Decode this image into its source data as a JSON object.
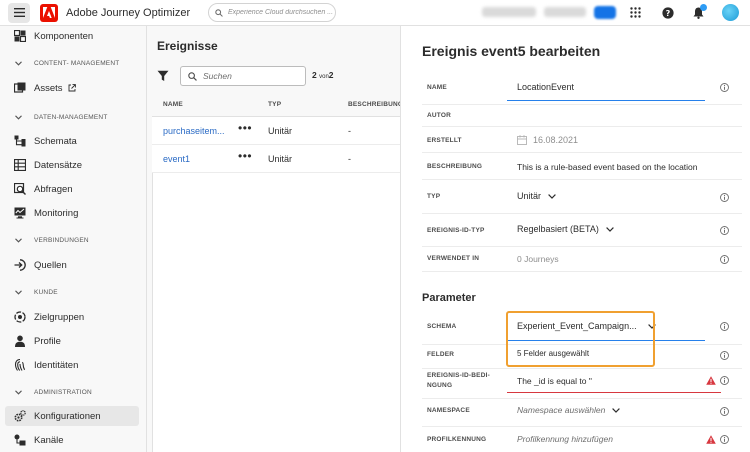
{
  "app": {
    "title": "Adobe Journey Optimizer",
    "search_placeholder": "Experience Cloud durchsuchen ..."
  },
  "nav": {
    "items": [
      {
        "label": "Komponenten",
        "icon": "components-icon"
      },
      {
        "label": "Assets",
        "icon": "assets-icon"
      },
      {
        "label": "Schemata",
        "icon": "schema-icon"
      },
      {
        "label": "Datensätze",
        "icon": "datasets-icon"
      },
      {
        "label": "Abfragen",
        "icon": "queries-icon"
      },
      {
        "label": "Monitoring",
        "icon": "monitoring-icon"
      },
      {
        "label": "Quellen",
        "icon": "sources-icon"
      },
      {
        "label": "Zielgruppen",
        "icon": "audiences-icon"
      },
      {
        "label": "Profile",
        "icon": "profile-icon"
      },
      {
        "label": "Identitäten",
        "icon": "identities-icon"
      },
      {
        "label": "Konfigurationen",
        "icon": "gear-icon",
        "active": true
      },
      {
        "label": "Kanäle",
        "icon": "channels-icon"
      }
    ],
    "sections": [
      "CONTENT- MANAGEMENT",
      "DATEN-MANAGEMENT",
      "VERBINDUNGEN",
      "KUNDE",
      "ADMINISTRATION"
    ]
  },
  "events": {
    "title": "Ereignisse",
    "search_placeholder": "Suchen",
    "count": "2",
    "count_of": "von",
    "count_total": "2",
    "columns": {
      "name": "NAME",
      "type": "TYP",
      "description": "BESCHREIBUNG"
    },
    "rows": [
      {
        "name": "purchaseitem...",
        "more": "•••",
        "type": "Unitär",
        "description": "-"
      },
      {
        "name": "event1",
        "more": "•••",
        "type": "Unitär",
        "description": "-"
      }
    ]
  },
  "editor": {
    "title": "Ereignis event5 bearbeiten",
    "fields": {
      "name": {
        "label": "NAME",
        "value": "LocationEvent"
      },
      "author": {
        "label": "AUTOR",
        "value": ""
      },
      "created": {
        "label": "ERSTELLT",
        "value": "16.08.2021"
      },
      "description": {
        "label": "BESCHREIBUNG",
        "value": "This is a rule-based event based on the location"
      },
      "type": {
        "label": "TYP",
        "value": "Unitär"
      },
      "id_type": {
        "label": "EREIGNIS-ID-TYP",
        "value": "Regelbasiert (BETA)"
      },
      "used_in": {
        "label": "VERWENDET IN",
        "value": "0 Journeys"
      }
    },
    "parameters": {
      "title": "Parameter",
      "schema": {
        "label": "SCHEMA",
        "value": "Experient_Event_Campaign..."
      },
      "fields": {
        "label": "FELDER",
        "value": "5 Felder ausgewählt"
      },
      "id_condition": {
        "label_line1": "EREIGNIS-ID-BEDI-",
        "label_line2": "NGUNG",
        "value": "The _id is equal to \""
      },
      "namespace": {
        "label": "NAMESPACE",
        "placeholder": "Namespace auswählen"
      },
      "profile_id": {
        "label": "PROFILKENNUNG",
        "placeholder": "Profilkennung hinzufügen"
      }
    }
  },
  "colors": {
    "accent": "#2680eb",
    "link": "#2b6bc5",
    "highlight": "#f0a030",
    "error": "#d7373f",
    "brand": "#eb1000"
  }
}
